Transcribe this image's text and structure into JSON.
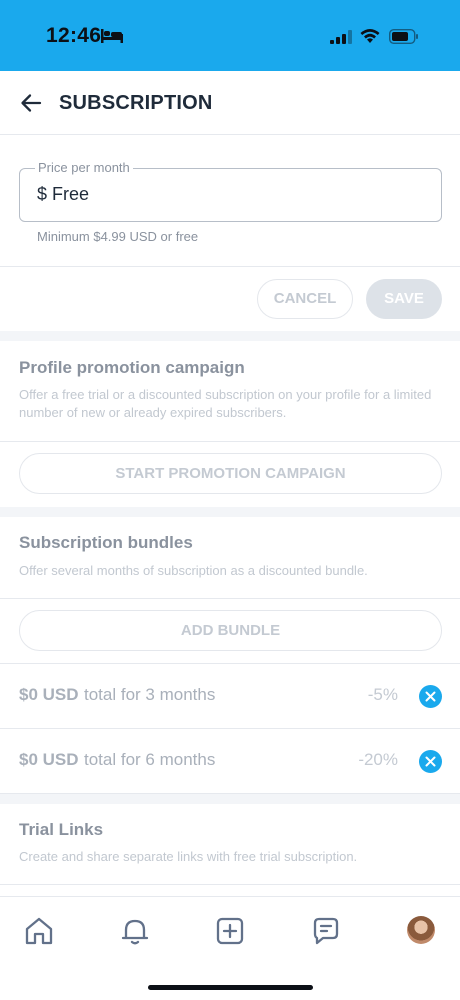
{
  "status_bar": {
    "time": "12:46",
    "accent": "#1aa9ed"
  },
  "header": {
    "title": "SUBSCRIPTION",
    "back_icon": "arrow-left-icon"
  },
  "price": {
    "label": "Price per month",
    "value": "$ Free",
    "hint": "Minimum $4.99 USD or free"
  },
  "actions": {
    "cancel": "CANCEL",
    "save": "SAVE"
  },
  "promotion": {
    "title": "Profile promotion campaign",
    "description": "Offer a free trial or a discounted subscription on your profile for a limited number of new or already expired subscribers.",
    "button": "START PROMOTION CAMPAIGN"
  },
  "bundles": {
    "title": "Subscription bundles",
    "description": "Offer several months of subscription as a discounted bundle.",
    "button": "ADD BUNDLE",
    "items": [
      {
        "amount": "$0 USD",
        "text": "total for 3 months",
        "discount": "-5%"
      },
      {
        "amount": "$0 USD",
        "text": "total for 6 months",
        "discount": "-20%"
      }
    ]
  },
  "trial": {
    "title": "Trial Links",
    "description": "Create and share separate links with free trial subscription."
  },
  "tabbar": {
    "items": [
      "home-icon",
      "bell-icon",
      "add-post-icon",
      "messages-icon",
      "profile-avatar"
    ]
  }
}
